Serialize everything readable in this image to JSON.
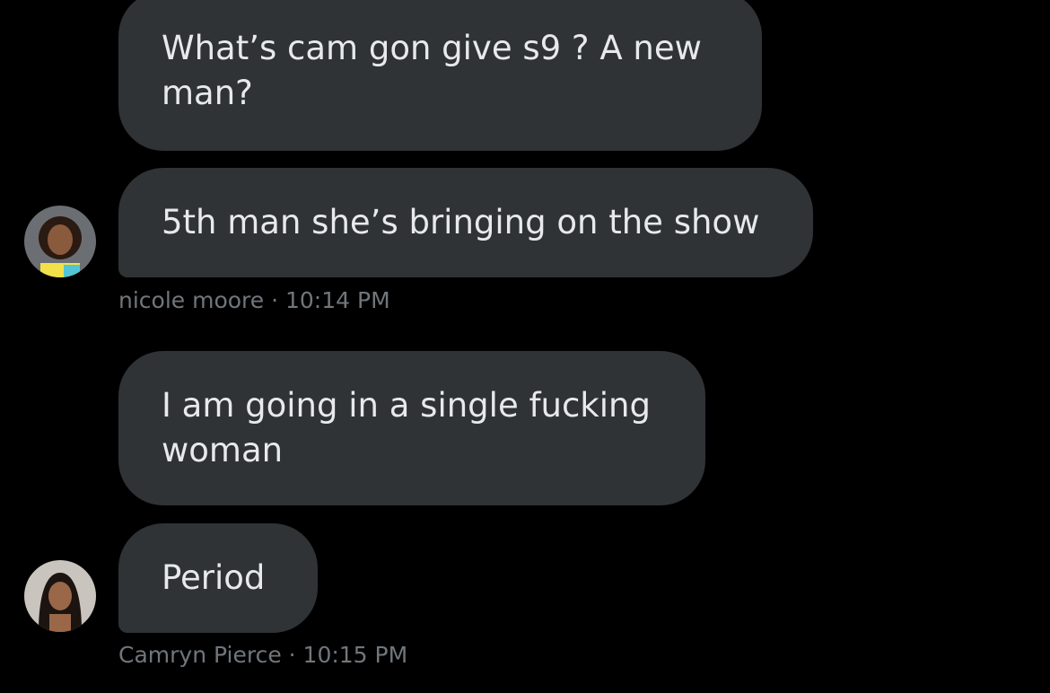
{
  "messages": [
    {
      "text": "What’s cam gon give s9 ? A new man?"
    },
    {
      "text": "5th man she’s bringing on the show"
    },
    {
      "text": "I am going in a single fucking woman"
    },
    {
      "text": "Period"
    }
  ],
  "meta": [
    {
      "sender": "nicole moore",
      "time": "10:14 PM",
      "line": "nicole moore · 10:14 PM"
    },
    {
      "sender": "Camryn Pierce",
      "time": "10:15 PM",
      "line": "Camryn Pierce · 10:15 PM"
    }
  ],
  "colors": {
    "background": "#000000",
    "bubble": "#2f3336",
    "text": "#e7e9ea",
    "meta": "#71767b"
  },
  "icons": {
    "avatar1": "avatar-photo",
    "avatar2": "avatar-photo"
  }
}
